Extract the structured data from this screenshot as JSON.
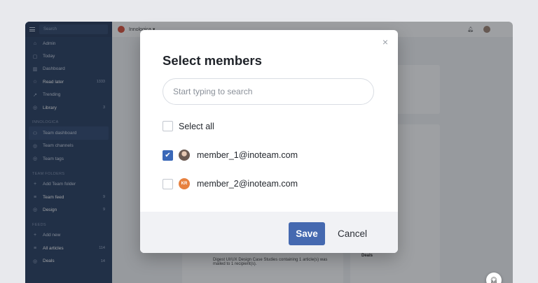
{
  "sidebar": {
    "search_placeholder": "Search",
    "items_top": [
      {
        "icon": "home-icon",
        "glyph": "⌂",
        "label": "Admin",
        "count": ""
      },
      {
        "icon": "calendar-icon",
        "glyph": "▢",
        "label": "Today",
        "count": ""
      },
      {
        "icon": "dashboard-icon",
        "glyph": "▥",
        "label": "Dashboard",
        "count": ""
      },
      {
        "icon": "star-icon",
        "glyph": "☆",
        "label": "Read later",
        "count": "1333"
      },
      {
        "icon": "trending-icon",
        "glyph": "↗",
        "label": "Trending",
        "count": ""
      },
      {
        "icon": "library-icon",
        "glyph": "◎",
        "label": "Library",
        "count": "3"
      }
    ],
    "section_innologica": "INNOLOGICA",
    "items_team": [
      {
        "icon": "team-icon",
        "glyph": "⚇",
        "label": "Team dashboard",
        "count": ""
      },
      {
        "icon": "channel-icon",
        "glyph": "◎",
        "label": "Team channels",
        "count": ""
      },
      {
        "icon": "tag-icon",
        "glyph": "◎",
        "label": "Team tags",
        "count": ""
      }
    ],
    "section_folders": "TEAM FOLDERS",
    "items_folders": [
      {
        "icon": "plus-icon",
        "glyph": "+",
        "label": "Add Team folder",
        "count": ""
      },
      {
        "icon": "feed-icon",
        "glyph": "≡",
        "label": "Team feed",
        "count": "9"
      },
      {
        "icon": "design-icon",
        "glyph": "◎",
        "label": "Design",
        "count": "9"
      }
    ],
    "section_feeds": "FEEDS",
    "items_feeds": [
      {
        "icon": "plus-icon",
        "glyph": "+",
        "label": "Add new",
        "count": ""
      },
      {
        "icon": "articles-icon",
        "glyph": "≡",
        "label": "All articles",
        "count": "114"
      },
      {
        "icon": "deals-icon",
        "glyph": "◎",
        "label": "Deals",
        "count": "14"
      }
    ]
  },
  "topbar": {
    "workspace": "Innologica ▾"
  },
  "background": {
    "digest_text": "Digest UI/UX Design Case Studies containing 1 article(s) was mailed to 1 recipient(s).",
    "deals_label": "Deals"
  },
  "modal": {
    "title": "Select members",
    "close_glyph": "×",
    "search_placeholder": "Start typing to search",
    "select_all_label": "Select all",
    "members": [
      {
        "email": "member_1@inoteam.com",
        "checked": true,
        "avatar_initials": ""
      },
      {
        "email": "member_2@inoteam.com",
        "checked": false,
        "avatar_initials": "KR"
      }
    ],
    "save_label": "Save",
    "cancel_label": "Cancel"
  },
  "colors": {
    "sidebar_bg": "#1d3358",
    "accent": "#4569b0",
    "checkbox_checked": "#3a68b8",
    "avatar_kr": "#e7813f"
  }
}
